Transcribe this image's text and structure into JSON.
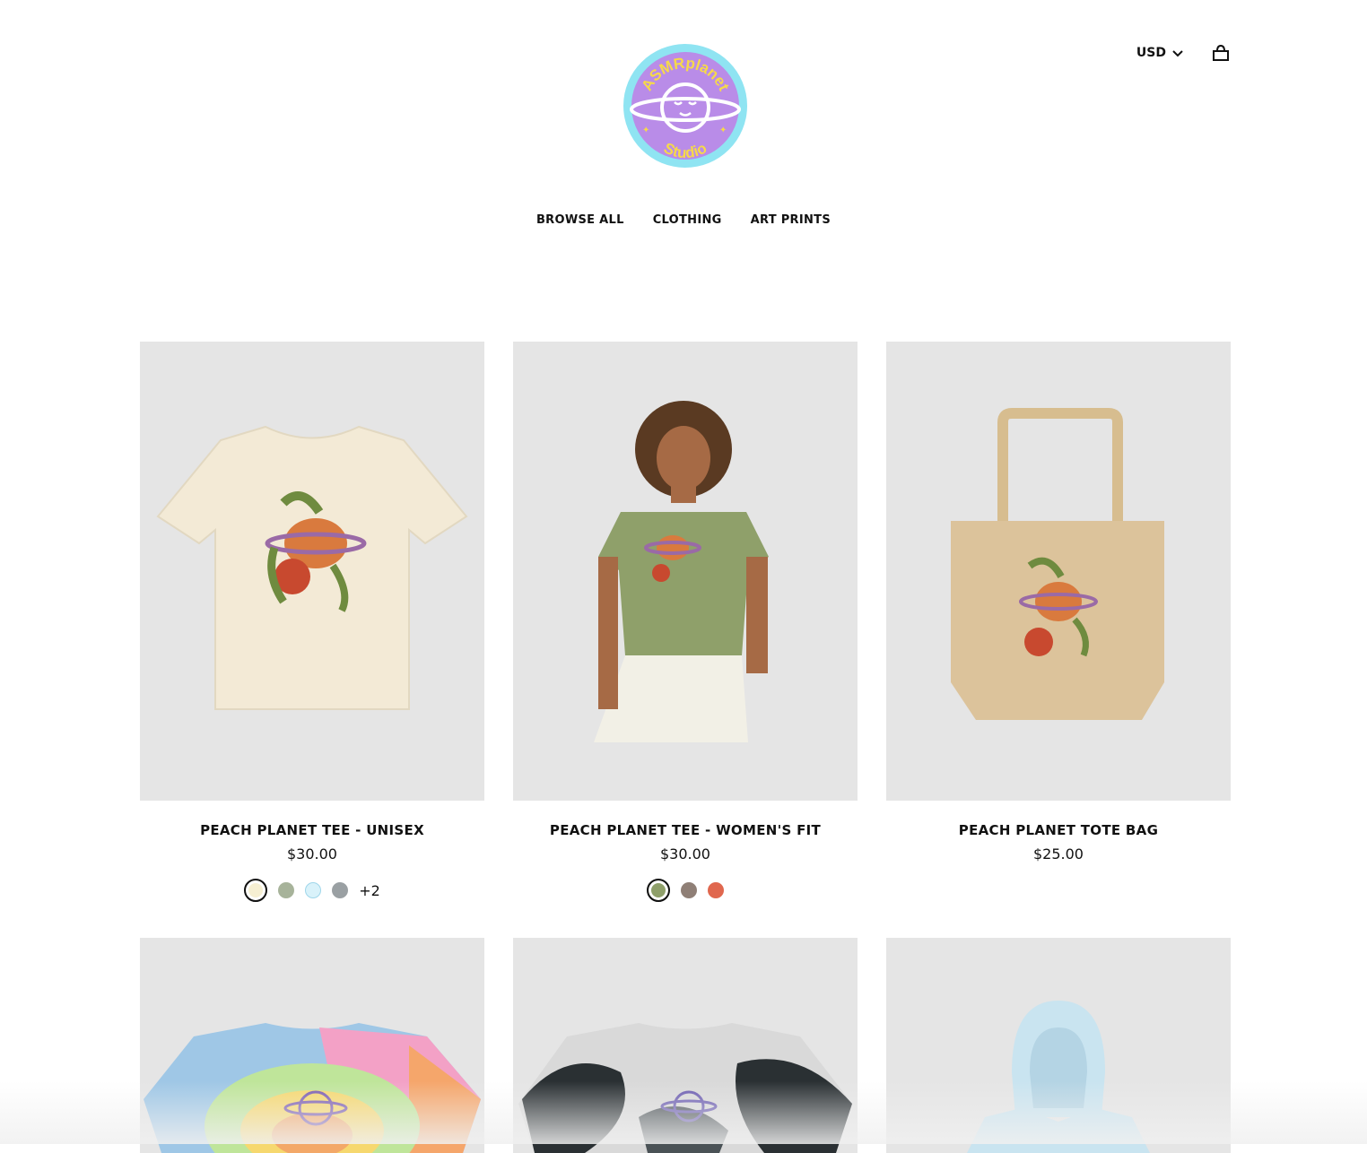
{
  "header": {
    "logo_text_top": "ASMRplanet",
    "logo_text_bottom": "Studio",
    "currency": "USD"
  },
  "nav": {
    "items": [
      {
        "label": "BROWSE ALL"
      },
      {
        "label": "CLOTHING"
      },
      {
        "label": "ART PRINTS"
      }
    ]
  },
  "products": [
    {
      "title": "PEACH PLANET TEE - UNISEX",
      "price": "$30.00",
      "swatches": [
        "#f6efd2",
        "#a7b39a",
        "#d9f2fa",
        "#9aa0a3"
      ],
      "more": "+2"
    },
    {
      "title": "PEACH PLANET TEE - WOMEN'S FIT",
      "price": "$30.00",
      "swatches": [
        "#8fa06a",
        "#8f7f76",
        "#e0674e"
      ]
    },
    {
      "title": "PEACH PLANET TOTE BAG",
      "price": "$25.00"
    }
  ],
  "colors": {
    "accent": "#111111",
    "image_bg": "#e5e5e5",
    "logo_ring": "#7fe0f0",
    "logo_fill": "#b98ce8",
    "logo_text": "#f6d94a"
  }
}
